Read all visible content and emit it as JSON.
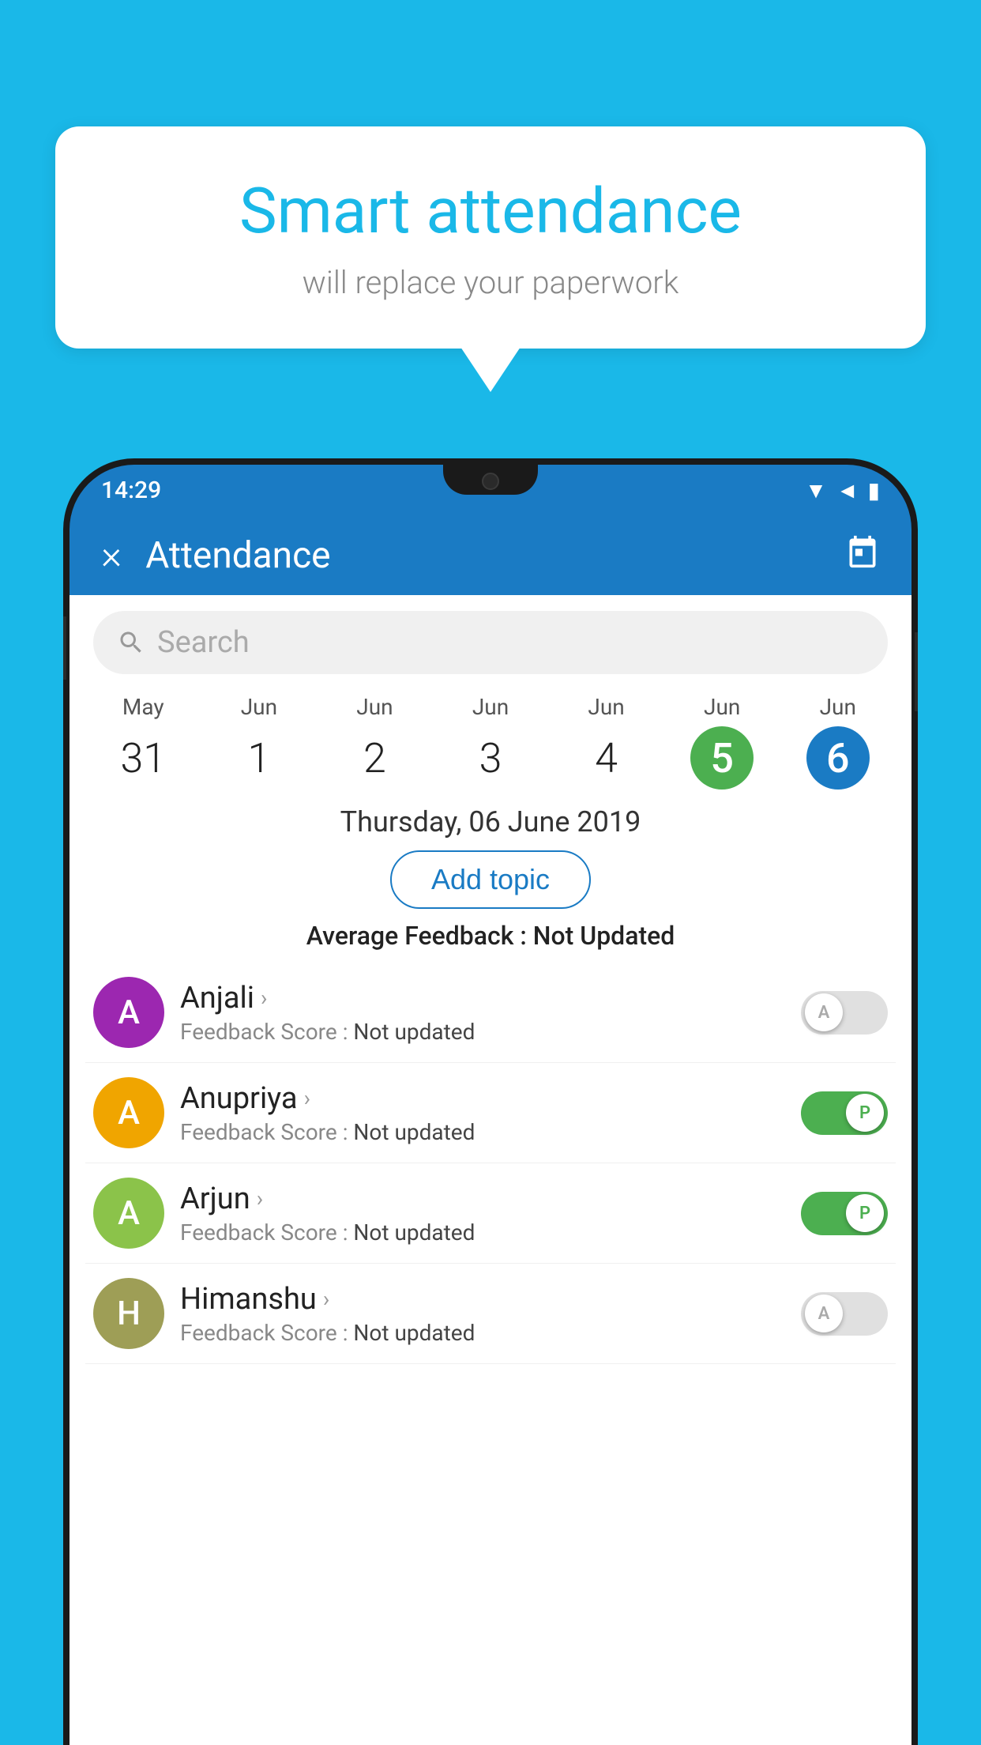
{
  "background": {
    "color": "#1ab8e8"
  },
  "bubble": {
    "title": "Smart attendance",
    "subtitle": "will replace your paperwork"
  },
  "status_bar": {
    "time": "14:29",
    "icons": [
      "▼",
      "◄",
      "▮"
    ]
  },
  "app_header": {
    "title": "Attendance",
    "close_label": "×",
    "calendar_icon": "📅"
  },
  "search": {
    "placeholder": "Search"
  },
  "calendar": {
    "days": [
      {
        "month": "May",
        "num": "31",
        "style": "normal"
      },
      {
        "month": "Jun",
        "num": "1",
        "style": "normal"
      },
      {
        "month": "Jun",
        "num": "2",
        "style": "normal"
      },
      {
        "month": "Jun",
        "num": "3",
        "style": "normal"
      },
      {
        "month": "Jun",
        "num": "4",
        "style": "normal"
      },
      {
        "month": "Jun",
        "num": "5",
        "style": "green"
      },
      {
        "month": "Jun",
        "num": "6",
        "style": "blue"
      }
    ]
  },
  "selected_date": "Thursday, 06 June 2019",
  "add_topic_label": "Add topic",
  "average_feedback": {
    "label": "Average Feedback : ",
    "value": "Not Updated"
  },
  "students": [
    {
      "name": "Anjali",
      "avatar_letter": "A",
      "avatar_color": "#9c27b0",
      "feedback_label": "Feedback Score : ",
      "feedback_value": "Not updated",
      "toggle": "off",
      "toggle_letter": "A"
    },
    {
      "name": "Anupriya",
      "avatar_letter": "A",
      "avatar_color": "#f0a500",
      "feedback_label": "Feedback Score : ",
      "feedback_value": "Not updated",
      "toggle": "on",
      "toggle_letter": "P"
    },
    {
      "name": "Arjun",
      "avatar_letter": "A",
      "avatar_color": "#8bc34a",
      "feedback_label": "Feedback Score : ",
      "feedback_value": "Not updated",
      "toggle": "on",
      "toggle_letter": "P"
    },
    {
      "name": "Himanshu",
      "avatar_letter": "H",
      "avatar_color": "#9e9e56",
      "feedback_label": "Feedback Score : ",
      "feedback_value": "Not updated",
      "toggle": "off",
      "toggle_letter": "A"
    }
  ]
}
